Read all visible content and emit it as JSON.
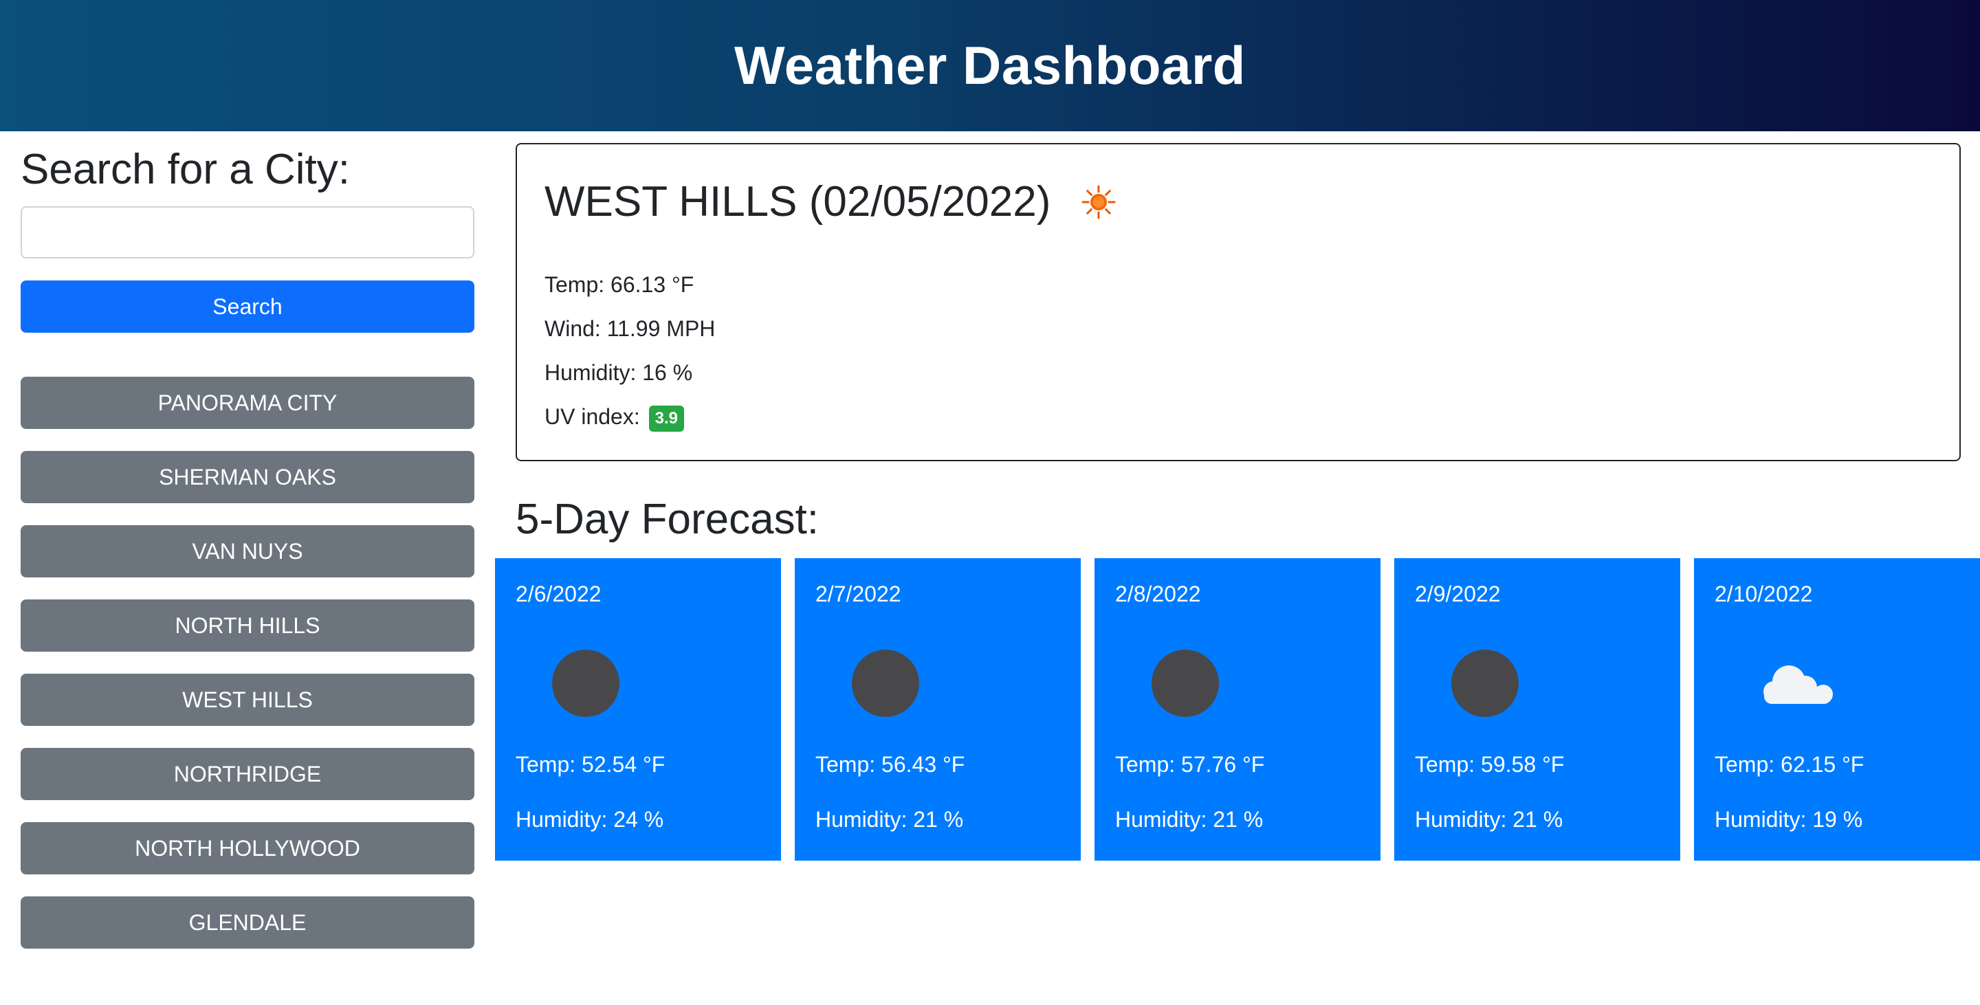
{
  "header": {
    "title": "Weather Dashboard"
  },
  "sidebar": {
    "title": "Search for a City:",
    "search_value": "",
    "search_placeholder": "",
    "search_button_label": "Search",
    "history": [
      "PANORAMA CITY",
      "SHERMAN OAKS",
      "VAN NUYS",
      "NORTH HILLS",
      "WEST HILLS",
      "NORTHRIDGE",
      "NORTH HOLLYWOOD",
      "GLENDALE"
    ]
  },
  "current": {
    "title": "WEST HILLS (02/05/2022)",
    "icon": "sun-icon",
    "temp": "Temp: 66.13 °F",
    "wind": "Wind: 11.99 MPH",
    "humidity": "Humidity: 16 %",
    "uv_label": "UV index:",
    "uv_value": "3.9",
    "uv_color": "#28a745"
  },
  "forecast": {
    "title": "5-Day Forecast:",
    "days": [
      {
        "date": "2/6/2022",
        "icon": "dark-circle-icon",
        "temp": "Temp: 52.54 °F",
        "humidity": "Humidity: 24 %"
      },
      {
        "date": "2/7/2022",
        "icon": "dark-circle-icon",
        "temp": "Temp: 56.43 °F",
        "humidity": "Humidity: 21 %"
      },
      {
        "date": "2/8/2022",
        "icon": "dark-circle-icon",
        "temp": "Temp: 57.76 °F",
        "humidity": "Humidity: 21 %"
      },
      {
        "date": "2/9/2022",
        "icon": "dark-circle-icon",
        "temp": "Temp: 59.58 °F",
        "humidity": "Humidity: 21 %"
      },
      {
        "date": "2/10/2022",
        "icon": "cloud-icon",
        "temp": "Temp: 62.15 °F",
        "humidity": "Humidity: 19 %"
      }
    ]
  },
  "colors": {
    "primary": "#007bff",
    "search_button": "#0d6efd",
    "history_button": "#6c757d"
  }
}
